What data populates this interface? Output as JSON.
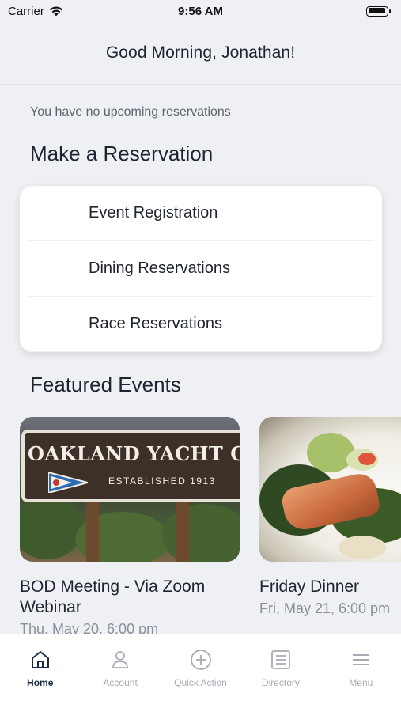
{
  "status_bar": {
    "carrier": "Carrier",
    "time": "9:56 AM"
  },
  "header": {
    "greeting": "Good Morning, Jonathan!"
  },
  "reservations": {
    "empty_message": "You have no upcoming reservations",
    "section_title": "Make a Reservation",
    "items": [
      {
        "label": "Event Registration"
      },
      {
        "label": "Dining Reservations"
      },
      {
        "label": "Race Reservations"
      }
    ]
  },
  "featured": {
    "section_title": "Featured Events",
    "events": [
      {
        "title": "BOD Meeting - Via Zoom Webinar",
        "date": "Thu, May 20, 6:00 pm",
        "image_text": "OAKLAND YACHT CLUB",
        "image_subtext": "ESTABLISHED 1913"
      },
      {
        "title": "Friday Dinner",
        "date": "Fri, May 21, 6:00 pm"
      }
    ]
  },
  "tabs": [
    {
      "label": "Home",
      "icon": "home-icon",
      "active": true
    },
    {
      "label": "Account",
      "icon": "person-icon",
      "active": false
    },
    {
      "label": "Quick Action",
      "icon": "plus-circle-icon",
      "active": false
    },
    {
      "label": "Directory",
      "icon": "list-icon",
      "active": false
    },
    {
      "label": "Menu",
      "icon": "hamburger-icon",
      "active": false
    }
  ],
  "colors": {
    "background": "#eef0f4",
    "active_tab": "#1b2a48",
    "inactive_tab": "#a7abb3"
  }
}
